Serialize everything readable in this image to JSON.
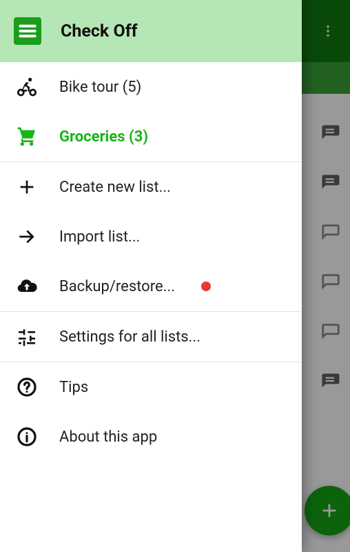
{
  "colors": {
    "accent": "#18b418",
    "toolbar": "#0f7a0f",
    "drawer_header": "#b5e6b5",
    "fab": "#15a515",
    "alert_dot": "#e53935"
  },
  "app": {
    "title": "Check Off"
  },
  "drawer": {
    "lists": [
      {
        "label": "Bike tour (5)",
        "icon": "cyclist-icon",
        "active": false
      },
      {
        "label": "Groceries (3)",
        "icon": "cart-icon",
        "active": true
      }
    ],
    "actions": [
      {
        "label": "Create new list...",
        "icon": "plus-icon"
      },
      {
        "label": "Import list...",
        "icon": "arrow-right-icon"
      },
      {
        "label": "Backup/restore...",
        "icon": "cloud-upload-icon",
        "has_dot": true
      }
    ],
    "settings": [
      {
        "label": "Settings for all lists...",
        "icon": "sliders-icon"
      }
    ],
    "meta": [
      {
        "label": "Tips",
        "icon": "help-icon"
      },
      {
        "label": "About this app",
        "icon": "info-icon"
      }
    ]
  },
  "background": {
    "row_icons": [
      "filled",
      "filled",
      "outline",
      "outline",
      "outline",
      "filled"
    ]
  }
}
